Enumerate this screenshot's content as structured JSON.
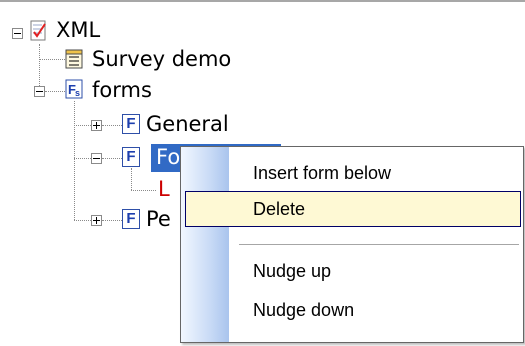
{
  "tree": {
    "root": {
      "label": "XML"
    },
    "survey": {
      "label": "Survey demo"
    },
    "forms": {
      "label": "forms"
    },
    "general": {
      "label": "General"
    },
    "selected_form": {
      "label": "Fo"
    },
    "red_child": {
      "label": "L"
    },
    "pe_form": {
      "label": "Pe"
    }
  },
  "context_menu": {
    "insert_form_below": "Insert form below",
    "delete": "Delete",
    "nudge_up": "Nudge up",
    "nudge_down": "Nudge down"
  }
}
